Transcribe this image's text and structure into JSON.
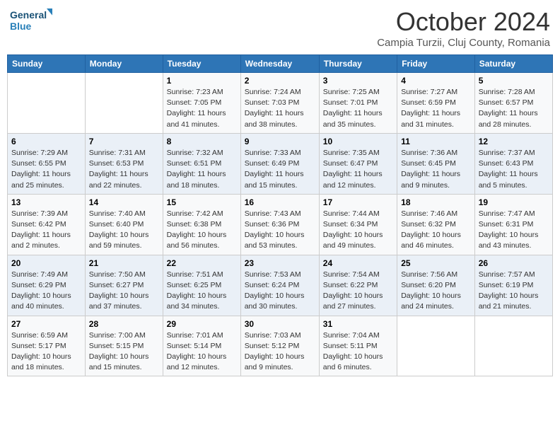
{
  "header": {
    "logo_text_general": "General",
    "logo_text_blue": "Blue",
    "month_title": "October 2024",
    "location": "Campia Turzii, Cluj County, Romania"
  },
  "days_of_week": [
    "Sunday",
    "Monday",
    "Tuesday",
    "Wednesday",
    "Thursday",
    "Friday",
    "Saturday"
  ],
  "weeks": [
    [
      {
        "day": "",
        "content": ""
      },
      {
        "day": "",
        "content": ""
      },
      {
        "day": "1",
        "content": "Sunrise: 7:23 AM\nSunset: 7:05 PM\nDaylight: 11 hours and 41 minutes."
      },
      {
        "day": "2",
        "content": "Sunrise: 7:24 AM\nSunset: 7:03 PM\nDaylight: 11 hours and 38 minutes."
      },
      {
        "day": "3",
        "content": "Sunrise: 7:25 AM\nSunset: 7:01 PM\nDaylight: 11 hours and 35 minutes."
      },
      {
        "day": "4",
        "content": "Sunrise: 7:27 AM\nSunset: 6:59 PM\nDaylight: 11 hours and 31 minutes."
      },
      {
        "day": "5",
        "content": "Sunrise: 7:28 AM\nSunset: 6:57 PM\nDaylight: 11 hours and 28 minutes."
      }
    ],
    [
      {
        "day": "6",
        "content": "Sunrise: 7:29 AM\nSunset: 6:55 PM\nDaylight: 11 hours and 25 minutes."
      },
      {
        "day": "7",
        "content": "Sunrise: 7:31 AM\nSunset: 6:53 PM\nDaylight: 11 hours and 22 minutes."
      },
      {
        "day": "8",
        "content": "Sunrise: 7:32 AM\nSunset: 6:51 PM\nDaylight: 11 hours and 18 minutes."
      },
      {
        "day": "9",
        "content": "Sunrise: 7:33 AM\nSunset: 6:49 PM\nDaylight: 11 hours and 15 minutes."
      },
      {
        "day": "10",
        "content": "Sunrise: 7:35 AM\nSunset: 6:47 PM\nDaylight: 11 hours and 12 minutes."
      },
      {
        "day": "11",
        "content": "Sunrise: 7:36 AM\nSunset: 6:45 PM\nDaylight: 11 hours and 9 minutes."
      },
      {
        "day": "12",
        "content": "Sunrise: 7:37 AM\nSunset: 6:43 PM\nDaylight: 11 hours and 5 minutes."
      }
    ],
    [
      {
        "day": "13",
        "content": "Sunrise: 7:39 AM\nSunset: 6:42 PM\nDaylight: 11 hours and 2 minutes."
      },
      {
        "day": "14",
        "content": "Sunrise: 7:40 AM\nSunset: 6:40 PM\nDaylight: 10 hours and 59 minutes."
      },
      {
        "day": "15",
        "content": "Sunrise: 7:42 AM\nSunset: 6:38 PM\nDaylight: 10 hours and 56 minutes."
      },
      {
        "day": "16",
        "content": "Sunrise: 7:43 AM\nSunset: 6:36 PM\nDaylight: 10 hours and 53 minutes."
      },
      {
        "day": "17",
        "content": "Sunrise: 7:44 AM\nSunset: 6:34 PM\nDaylight: 10 hours and 49 minutes."
      },
      {
        "day": "18",
        "content": "Sunrise: 7:46 AM\nSunset: 6:32 PM\nDaylight: 10 hours and 46 minutes."
      },
      {
        "day": "19",
        "content": "Sunrise: 7:47 AM\nSunset: 6:31 PM\nDaylight: 10 hours and 43 minutes."
      }
    ],
    [
      {
        "day": "20",
        "content": "Sunrise: 7:49 AM\nSunset: 6:29 PM\nDaylight: 10 hours and 40 minutes."
      },
      {
        "day": "21",
        "content": "Sunrise: 7:50 AM\nSunset: 6:27 PM\nDaylight: 10 hours and 37 minutes."
      },
      {
        "day": "22",
        "content": "Sunrise: 7:51 AM\nSunset: 6:25 PM\nDaylight: 10 hours and 34 minutes."
      },
      {
        "day": "23",
        "content": "Sunrise: 7:53 AM\nSunset: 6:24 PM\nDaylight: 10 hours and 30 minutes."
      },
      {
        "day": "24",
        "content": "Sunrise: 7:54 AM\nSunset: 6:22 PM\nDaylight: 10 hours and 27 minutes."
      },
      {
        "day": "25",
        "content": "Sunrise: 7:56 AM\nSunset: 6:20 PM\nDaylight: 10 hours and 24 minutes."
      },
      {
        "day": "26",
        "content": "Sunrise: 7:57 AM\nSunset: 6:19 PM\nDaylight: 10 hours and 21 minutes."
      }
    ],
    [
      {
        "day": "27",
        "content": "Sunrise: 6:59 AM\nSunset: 5:17 PM\nDaylight: 10 hours and 18 minutes."
      },
      {
        "day": "28",
        "content": "Sunrise: 7:00 AM\nSunset: 5:15 PM\nDaylight: 10 hours and 15 minutes."
      },
      {
        "day": "29",
        "content": "Sunrise: 7:01 AM\nSunset: 5:14 PM\nDaylight: 10 hours and 12 minutes."
      },
      {
        "day": "30",
        "content": "Sunrise: 7:03 AM\nSunset: 5:12 PM\nDaylight: 10 hours and 9 minutes."
      },
      {
        "day": "31",
        "content": "Sunrise: 7:04 AM\nSunset: 5:11 PM\nDaylight: 10 hours and 6 minutes."
      },
      {
        "day": "",
        "content": ""
      },
      {
        "day": "",
        "content": ""
      }
    ]
  ]
}
